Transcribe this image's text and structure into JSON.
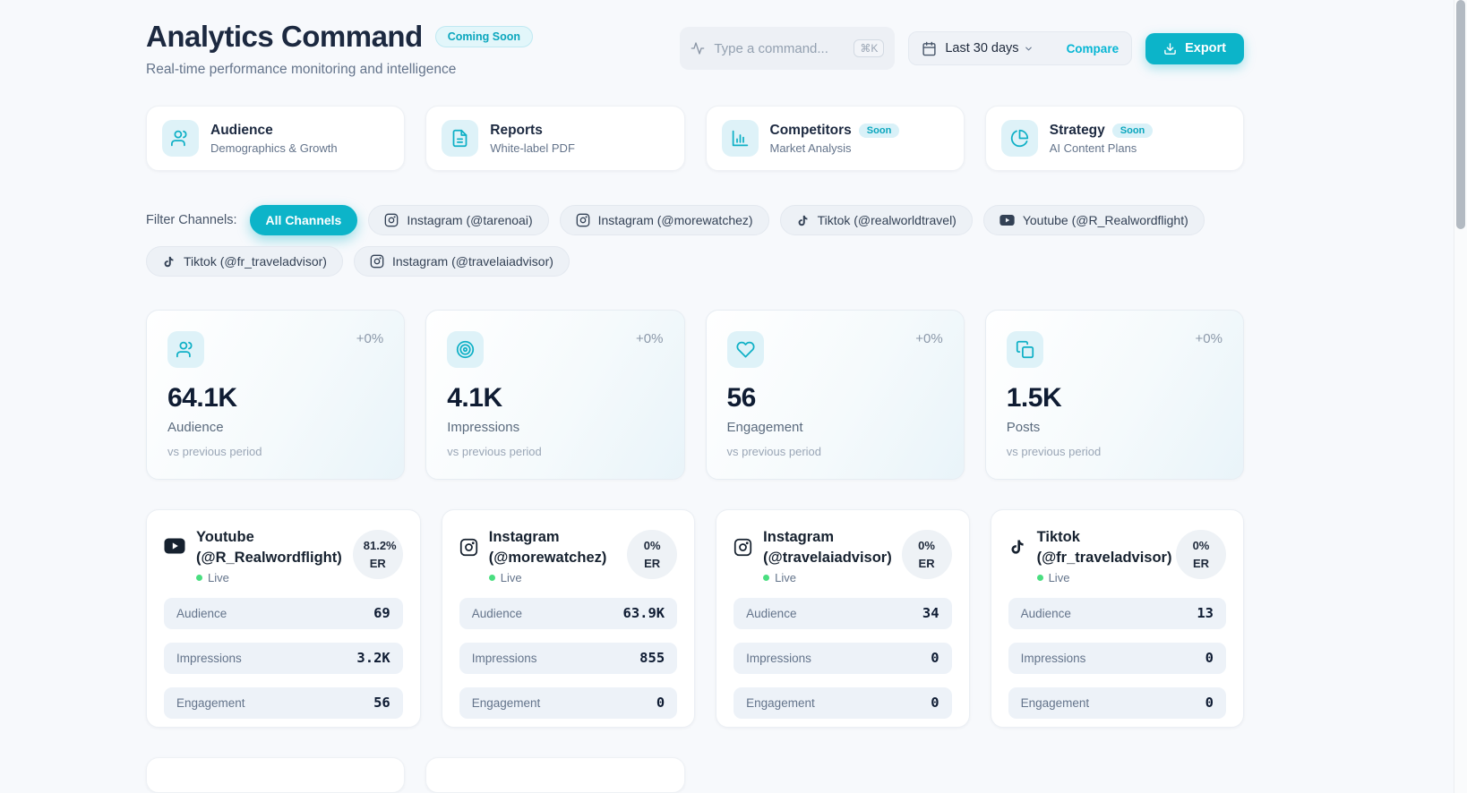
{
  "colors": {
    "accent": "#0cb4c9",
    "accent_light_bg": "#def2f8",
    "title_text": "#1c2940",
    "muted_text": "#64748b",
    "live_green": "#4ade80",
    "page_bg": "#f7f9fc"
  },
  "header": {
    "title": "Analytics Command",
    "badge": "Coming Soon",
    "subtitle": "Real-time performance monitoring and intelligence",
    "command": {
      "placeholder": "Type a command...",
      "shortcut": "⌘K"
    },
    "date_range": {
      "label": "Last 30 days",
      "compare_label": "Compare"
    },
    "export_label": "Export"
  },
  "nav_cards": [
    {
      "title": "Audience",
      "subtitle": "Demographics & Growth",
      "badge": "",
      "icon": "users-icon"
    },
    {
      "title": "Reports",
      "subtitle": "White-label PDF",
      "badge": "",
      "icon": "file-text-icon"
    },
    {
      "title": "Competitors",
      "subtitle": "Market Analysis",
      "badge": "Soon",
      "icon": "bar-chart-icon"
    },
    {
      "title": "Strategy",
      "subtitle": "AI Content Plans",
      "badge": "Soon",
      "icon": "pie-chart-icon"
    }
  ],
  "filters": {
    "label": "Filter Channels:",
    "all_label": "All Channels",
    "channels": [
      {
        "platform": "instagram",
        "label": "Instagram (@tarenoai)"
      },
      {
        "platform": "instagram",
        "label": "Instagram (@morewatchez)"
      },
      {
        "platform": "tiktok",
        "label": "Tiktok (@realworldtravel)"
      },
      {
        "platform": "youtube",
        "label": "Youtube (@R_Realwordflight)"
      },
      {
        "platform": "tiktok",
        "label": "Tiktok (@fr_traveladvisor)"
      },
      {
        "platform": "instagram",
        "label": "Instagram (@travelaiadvisor)"
      }
    ]
  },
  "stats": [
    {
      "value": "64.1K",
      "label": "Audience",
      "change": "+0%",
      "note": "vs previous period",
      "icon": "users-icon"
    },
    {
      "value": "4.1K",
      "label": "Impressions",
      "change": "+0%",
      "note": "vs previous period",
      "icon": "target-icon"
    },
    {
      "value": "56",
      "label": "Engagement",
      "change": "+0%",
      "note": "vs previous period",
      "icon": "heart-icon"
    },
    {
      "value": "1.5K",
      "label": "Posts",
      "change": "+0%",
      "note": "vs previous period",
      "icon": "copy-icon"
    }
  ],
  "channel_cards": [
    {
      "platform": "youtube",
      "name": "Youtube (@R_Realwordflight)",
      "status": "Live",
      "er": "81.2% ER",
      "metrics": [
        {
          "label": "Audience",
          "value": "69"
        },
        {
          "label": "Impressions",
          "value": "3.2K"
        },
        {
          "label": "Engagement",
          "value": "56"
        }
      ]
    },
    {
      "platform": "instagram",
      "name": "Instagram (@morewatchez)",
      "status": "Live",
      "er": "0% ER",
      "metrics": [
        {
          "label": "Audience",
          "value": "63.9K"
        },
        {
          "label": "Impressions",
          "value": "855"
        },
        {
          "label": "Engagement",
          "value": "0"
        }
      ]
    },
    {
      "platform": "instagram",
      "name": "Instagram (@travelaiadvisor)",
      "status": "Live",
      "er": "0% ER",
      "metrics": [
        {
          "label": "Audience",
          "value": "34"
        },
        {
          "label": "Impressions",
          "value": "0"
        },
        {
          "label": "Engagement",
          "value": "0"
        }
      ]
    },
    {
      "platform": "tiktok",
      "name": "Tiktok (@fr_traveladvisor)",
      "status": "Live",
      "er": "0% ER",
      "metrics": [
        {
          "label": "Audience",
          "value": "13"
        },
        {
          "label": "Impressions",
          "value": "0"
        },
        {
          "label": "Engagement",
          "value": "0"
        }
      ]
    }
  ]
}
